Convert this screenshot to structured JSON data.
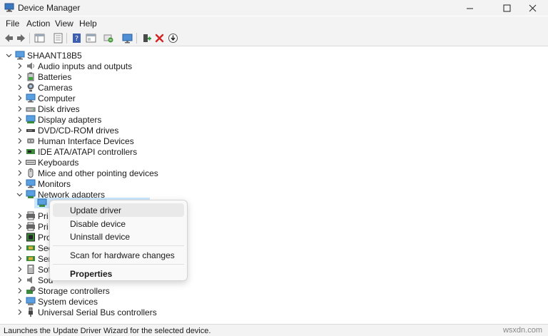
{
  "window": {
    "title": "Device Manager"
  },
  "menu": [
    "File",
    "Action",
    "View",
    "Help"
  ],
  "toolbar": {
    "icons": [
      "back-arrow-icon",
      "forward-arrow-icon",
      "show-hide-tree-icon",
      "properties-icon",
      "help-icon",
      "action-view-icon",
      "scan-hardware-icon",
      "monitor-icon",
      "add-driver-icon",
      "uninstall-x-icon",
      "update-driver-icon"
    ]
  },
  "tree": {
    "root": "SHAANT18B5",
    "categories": [
      "Audio inputs and outputs",
      "Batteries",
      "Cameras",
      "Computer",
      "Disk drives",
      "Display adapters",
      "DVD/CD-ROM drives",
      "Human Interface Devices",
      "IDE ATA/ATAPI controllers",
      "Keyboards",
      "Mice and other pointing devices",
      "Monitors",
      "Network adapters",
      "Pri",
      "Pri",
      "Pro",
      "Sec",
      "Ser",
      "Sof",
      "Sou",
      "Storage controllers",
      "System devices",
      "Universal Serial Bus controllers"
    ]
  },
  "context_menu": {
    "items": [
      "Update driver",
      "Disable device",
      "Uninstall device",
      "Scan for hardware changes",
      "Properties"
    ]
  },
  "status": {
    "text": "Launches the Update Driver Wizard for the selected device.",
    "watermark": "wsxdn.com"
  },
  "colors": {
    "selection": "#cce8ff",
    "chrome": "#f3f3f3",
    "accent": "#0063b1"
  }
}
